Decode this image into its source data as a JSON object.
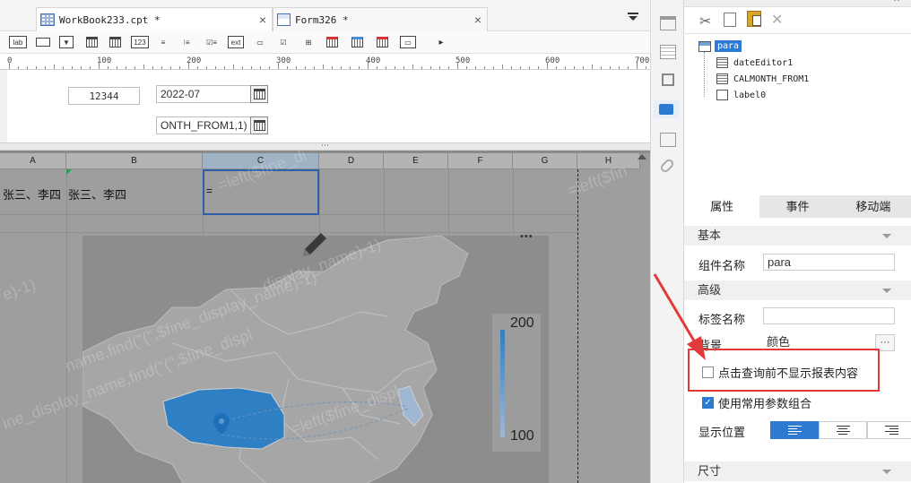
{
  "tabs": [
    {
      "label": "WorkBook233.cpt *",
      "close": "×"
    },
    {
      "label": "Form326 *",
      "close": "×"
    }
  ],
  "toolbar": {
    "items": [
      "lab",
      "▭",
      "▼",
      "▦",
      "▦",
      "123",
      "≡",
      "⁝≡",
      "☑≡",
      "ext",
      "▭",
      "☑",
      "⊞",
      "▦",
      "▦",
      "▦",
      "▭",
      "▸"
    ]
  },
  "ruler": {
    "labels": [
      "0",
      "100",
      "200",
      "300",
      "400",
      "500",
      "600",
      "700"
    ]
  },
  "params": {
    "label_value": "12344",
    "date_value": "2022-07",
    "calmonth_value": "ONTH_FROM1,1)"
  },
  "splitter_dots": "⋯",
  "sheet": {
    "columns": [
      "A",
      "B",
      "C",
      "D",
      "E",
      "F",
      "G",
      "H"
    ],
    "cell_a1": "张三、李四",
    "cell_b1": "张三、李四",
    "cell_c1": "=",
    "watermarks": [
      "=left($fine_di",
      "=left($fin",
      "e)-1)",
      "display_name)-1)",
      "name,find(\"(\",$fine_display_name)-1)",
      "ine_display_name,find(\"(\",$fine_displ",
      "=left($fine_displ"
    ],
    "more": "•••"
  },
  "map": {
    "legend_max": "200",
    "legend_min": "100",
    "colors": {
      "highlight": "#2f7fc4",
      "light": "#9fb7d3",
      "land": "#a9a9a9",
      "line": "#bdbdbd"
    }
  },
  "right": {
    "tree": {
      "root": "para",
      "children": [
        "dateEditor1",
        "CALMONTH_FROM1",
        "label0"
      ]
    },
    "panel_tabs": [
      "属性",
      "事件",
      "移动端"
    ],
    "sections": {
      "basic": "基本",
      "advanced": "高级",
      "size": "尺寸"
    },
    "fields": {
      "component_name_label": "组件名称",
      "component_name_value": "para",
      "tag_name_label": "标签名称",
      "tag_name_value": "",
      "background_label": "背景",
      "background_value": "颜色",
      "background_more": "···",
      "hide_before_query": "点击查询前不显示报表内容",
      "use_common_params": "使用常用参数组合",
      "display_position": "显示位置"
    }
  }
}
